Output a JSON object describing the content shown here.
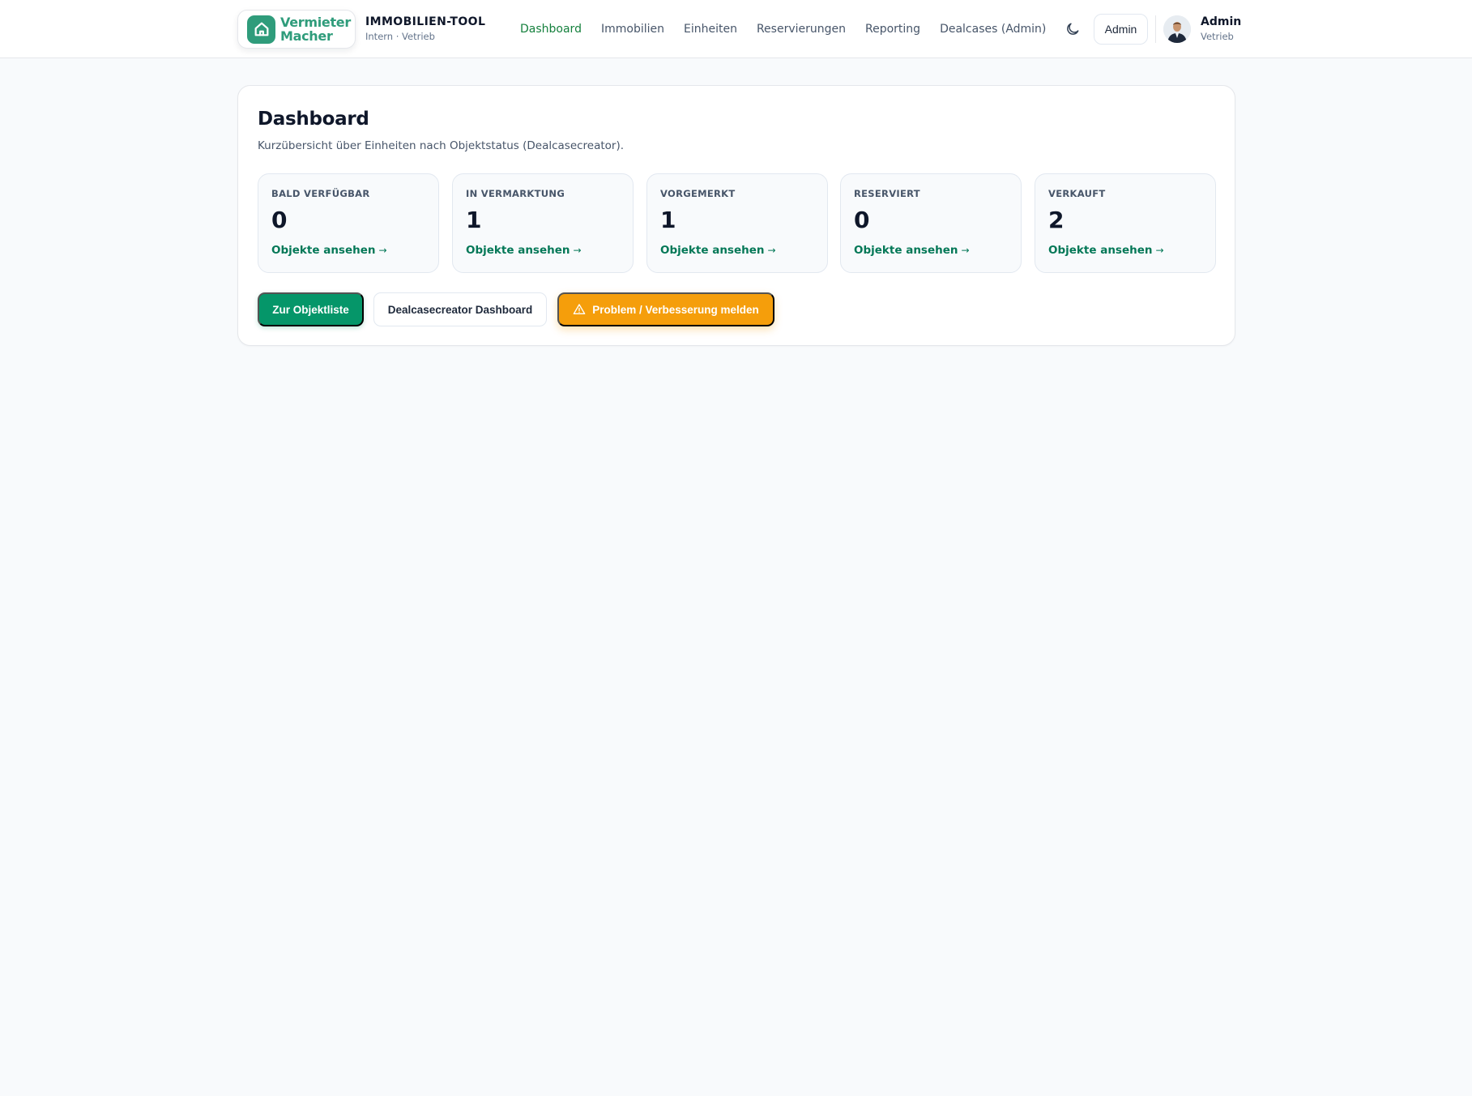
{
  "header": {
    "logo": {
      "line1": "Vermieter",
      "line2": "Macher",
      "icon": "house-icon",
      "color": "#2f9c7b"
    },
    "brand_title": "IMMOBILIEN-TOOL",
    "brand_subtitle": "Intern · Vetrieb",
    "nav": [
      {
        "label": "Dashboard",
        "active": true
      },
      {
        "label": "Immobilien",
        "active": false
      },
      {
        "label": "Einheiten",
        "active": false
      },
      {
        "label": "Reservierungen",
        "active": false
      },
      {
        "label": "Reporting",
        "active": false
      },
      {
        "label": "Dealcases (Admin)",
        "active": false
      }
    ],
    "theme_toggle_icon": "moon-icon",
    "role_button": "Admin",
    "user": {
      "name": "Admin",
      "role": "Vetrieb",
      "avatar": "user-avatar"
    }
  },
  "main": {
    "title": "Dashboard",
    "description": "Kurzübersicht über Einheiten nach Objektstatus (Dealcasecreator).",
    "stats": [
      {
        "label": "BALD VERFÜGBAR",
        "value": "0",
        "link": "Objekte ansehen",
        "arrow": "→"
      },
      {
        "label": "IN VERMARKTUNG",
        "value": "1",
        "link": "Objekte ansehen",
        "arrow": "→"
      },
      {
        "label": "VORGEMERKT",
        "value": "1",
        "link": "Objekte ansehen",
        "arrow": "→"
      },
      {
        "label": "RESERVIERT",
        "value": "0",
        "link": "Objekte ansehen",
        "arrow": "→"
      },
      {
        "label": "VERKAUFT",
        "value": "2",
        "link": "Objekte ansehen",
        "arrow": "→"
      }
    ],
    "buttons": {
      "primary": "Zur Objektliste",
      "secondary": "Dealcasecreator Dashboard",
      "warning": "Problem / Verbesserung melden",
      "warning_icon": "warning-triangle-icon"
    }
  },
  "colors": {
    "accent": "#059669",
    "nav_active": "#15803d",
    "link": "#047857",
    "warning": "#f59e0b",
    "background": "#f8fafc"
  }
}
